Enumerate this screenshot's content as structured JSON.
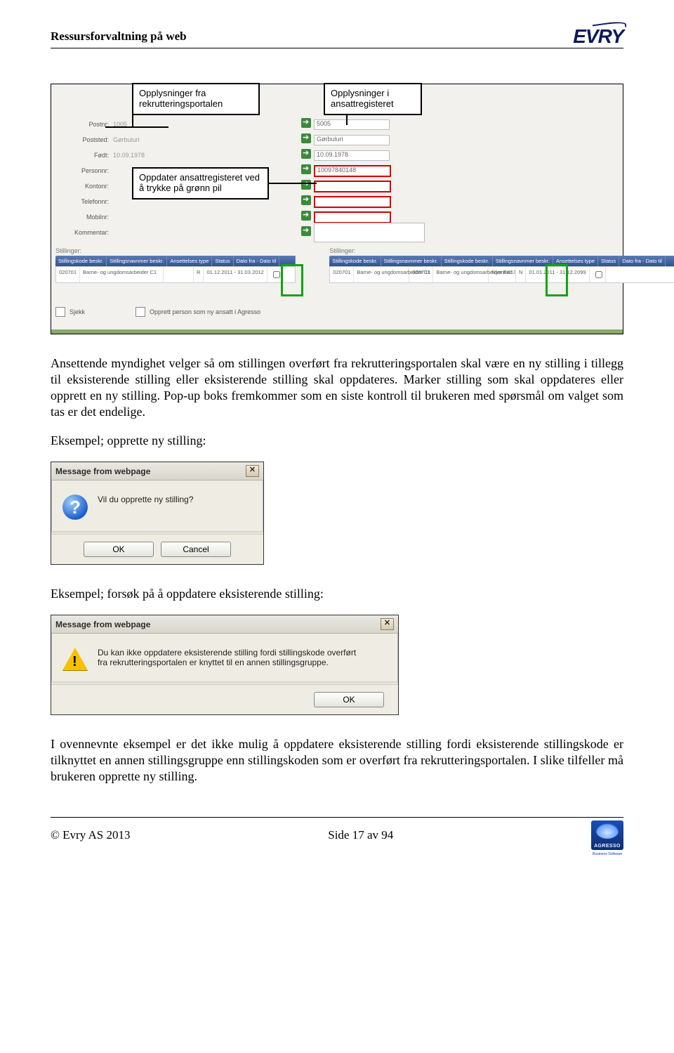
{
  "header": {
    "title": "Ressursforvaltning på web"
  },
  "logo": {
    "text": "EVRY"
  },
  "screenshot1": {
    "callouts": {
      "c1": "Opplysninger fra rekrutteringsportalen",
      "c2": "Opplysninger i ansattregisteret",
      "c3": "Oppdater ansattregisteret ved å trykke på grønn pil"
    },
    "fields": {
      "labels": {
        "postnr": "Postnr:",
        "poststed": "Poststed:",
        "fodt": "Født:",
        "personnr": "Personnr:",
        "kontonr": "Kontonr:",
        "telefonnr": "Telefonnr:",
        "mobilnr": "Mobilnr:",
        "kommentar": "Kommentar:"
      },
      "left": {
        "postnr": "1005",
        "poststed": "Gørbuluri",
        "fodt": "10.09.1978"
      },
      "right": {
        "postnr": "5005",
        "poststed": "Gørbuluri",
        "fodt": "10.09.1978",
        "personnr": "10097840148"
      }
    },
    "tables": {
      "titleLeft": "Stillinger:",
      "titleRight": "Stillinger:",
      "headers": {
        "h1": "Stillingskode beskr.",
        "h2": "Stillingsnavnmer beskr.",
        "h3": "Ansettelses type",
        "h4": "Status",
        "h5": "Dato fra - Dato til",
        "hchk": ""
      },
      "row": {
        "codeL": "020701",
        "descL": "Barne- og ungdomsarbeider C1",
        "typeL": "",
        "statL": "R",
        "dateL": "01.12.2011 - 31.03.2012",
        "codeR": "020701",
        "descR": "Barne- og ungdomsarbeider C1",
        "codeR2": "020701",
        "descR2": "Barne- og ungdomsarbeider EK13",
        "typeR": "Nyansatt",
        "statR": "N",
        "dateR": "01.01.2011 - 31.12.2099"
      }
    },
    "footer": {
      "sjekkTxt": "Sjekk",
      "opprettTxt": "Opprett person som ny ansatt i Agresso"
    }
  },
  "para1": "Ansettende myndighet velger så om stillingen overført fra rekrutteringsportalen skal være en ny stilling i tillegg til eksisterende stilling eller eksisterende stilling skal oppdateres. Marker stilling som skal oppdateres eller opprett en ny stilling. Pop-up boks fremkommer som en siste kontroll til brukeren med spørsmål om valget som tas er det endelige.",
  "para2": "Eksempel; opprette ny stilling:",
  "dlg1": {
    "title": "Message from webpage",
    "msg": "Vil du opprette ny stilling?",
    "ok": "OK",
    "cancel": "Cancel"
  },
  "para3": "Eksempel; forsøk på å oppdatere eksisterende stilling:",
  "dlg2": {
    "title": "Message from webpage",
    "msg": "Du kan ikke oppdatere eksisterende stilling fordi stillingskode overført fra rekrutteringsportalen er knyttet til en annen stillingsgruppe.",
    "ok": "OK"
  },
  "para4": "I ovennevnte eksempel er det ikke mulig å oppdatere eksisterende stilling fordi eksisterende stillingskode er tilknyttet en annen stillingsgruppe enn stillingskoden som er overført fra rekrutteringsportalen. I slike tilfeller må brukeren opprette ny stilling.",
  "footer": {
    "copyright": "© Evry AS 2013",
    "page": "Side 17 av 94",
    "agressoSub": "Business Software"
  }
}
